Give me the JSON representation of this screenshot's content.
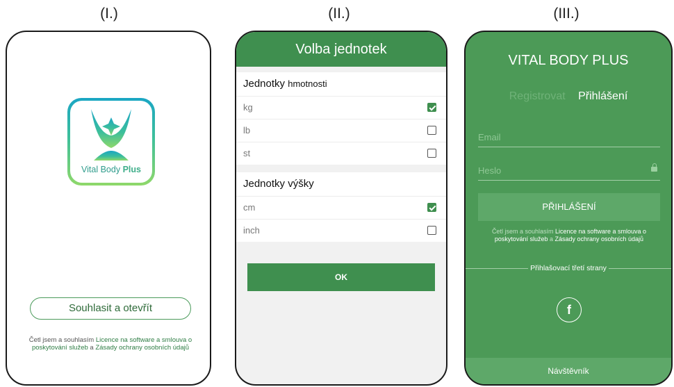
{
  "labels": [
    "(I.)",
    "(II.)",
    "(III.)"
  ],
  "screen1": {
    "logo_text_a": "Vital Body ",
    "logo_text_b": "Plus",
    "agree_button": "Souhlasit a otevřít",
    "legal_prefix": "Četl jsem a souhlasím ",
    "legal_link1": "Licence na software a smlouva o poskytování služeb",
    "legal_mid": " a ",
    "legal_link2": "Zásady ochrany osobních údajů"
  },
  "screen2": {
    "header": "Volba jednotek",
    "weight": {
      "title_a": "Jednotky ",
      "title_b": "hmotnosti",
      "options": [
        {
          "label": "kg",
          "checked": true
        },
        {
          "label": "lb",
          "checked": false
        },
        {
          "label": "st",
          "checked": false
        }
      ]
    },
    "height": {
      "title": "Jednotky výšky",
      "options": [
        {
          "label": "cm",
          "checked": true
        },
        {
          "label": "inch",
          "checked": false
        }
      ]
    },
    "ok_button": "OK"
  },
  "screen3": {
    "title": "VITAL BODY PLUS",
    "tab_register": "Registrovat",
    "tab_login": "Přihlášení",
    "email_placeholder": "Email",
    "password_placeholder": "Heslo",
    "login_button": "PŘIHLÁŠENÍ",
    "legal_prefix": "Četl jsem a souhlasím ",
    "legal_link1": "Licence na software a smlouva o poskytování služeb",
    "legal_mid": " a ",
    "legal_link2": "Zásady ochrany osobních údajů",
    "third_party": "Přihlašovací třetí strany",
    "facebook_glyph": "f",
    "visitor": "Návštěvník"
  },
  "colors": {
    "primary_green": "#3f8f4f",
    "screen3_bg": "#4c9a57"
  },
  "icons": [
    "app-logo-icon",
    "checkbox-checked-icon",
    "checkbox-empty-icon",
    "lock-icon",
    "facebook-icon"
  ]
}
